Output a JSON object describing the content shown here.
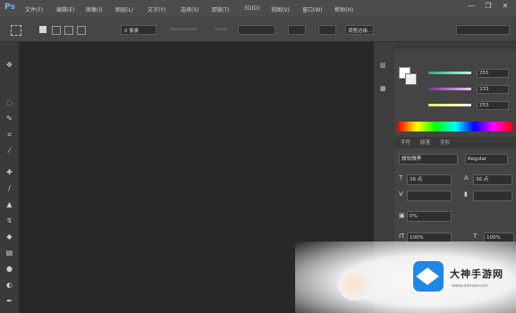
{
  "app": {
    "logo": "Ps"
  },
  "menu": {
    "items": [
      "文件(F)",
      "编辑(E)",
      "图像(I)",
      "图层(L)",
      "文字(Y)",
      "选择(S)",
      "滤镜(T)",
      "3D(D)",
      "视图(V)",
      "窗口(W)",
      "帮助(H)"
    ]
  },
  "window": {
    "minimize": "—",
    "restore": "❐",
    "close": "✕"
  },
  "options": {
    "size_label": "0 像素",
    "button_label": "调整边缘..."
  },
  "color_panel": {
    "r": "255",
    "g": "233",
    "b": "253"
  },
  "char_panel": {
    "tabs": [
      "字符",
      "段落",
      "字形"
    ],
    "font_family": "微软雅黑",
    "font_style": "Regular",
    "font_size": "26 点",
    "leading": "36 点",
    "tracking": "0%",
    "vscale": "100%",
    "hscale": "100%"
  },
  "watermark": {
    "title": "大神手游网",
    "url": "www.dshsw.com"
  }
}
